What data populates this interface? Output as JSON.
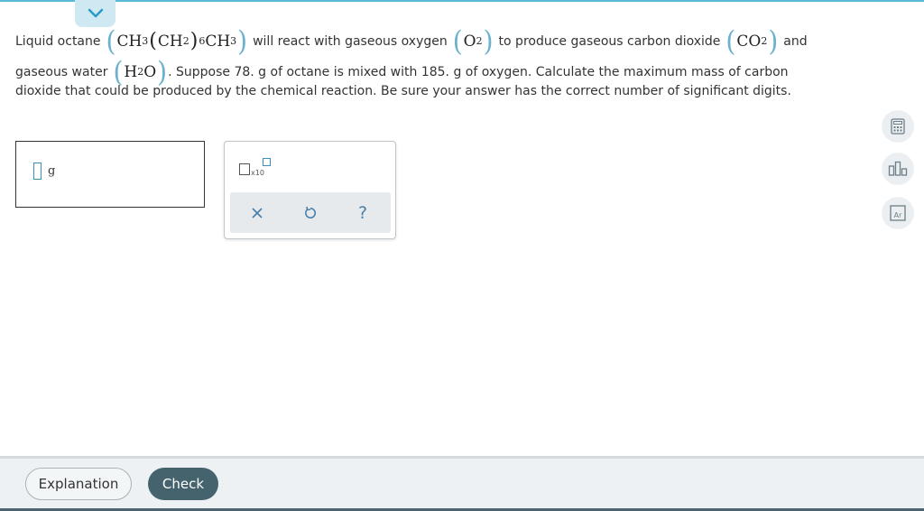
{
  "colors": {
    "accent": "#5bb8d6",
    "paren": "#6ab1cc",
    "check_button": "#44636d",
    "footer": "#eef1f3"
  },
  "question": {
    "t1": "Liquid octane",
    "octane": {
      "a": "CH",
      "a_sub": "3",
      "b": "CH",
      "b_sub": "2",
      "n": "6",
      "c": "CH",
      "c_sub": "3"
    },
    "t2": "will react with gaseous oxygen",
    "oxygen": {
      "a": "O",
      "a_sub": "2"
    },
    "t3": "to produce gaseous carbon dioxide",
    "co2": {
      "a": "CO",
      "a_sub": "2"
    },
    "t4": "and",
    "t5": "gaseous water",
    "water": {
      "a": "H",
      "a_sub": "2",
      "b": "O"
    },
    "t6": ". Suppose 78. g of octane is mixed with 185. g of oxygen. Calculate the maximum mass of carbon",
    "t7": "dioxide that could be produced by the chemical reaction. Be sure your answer has the correct number of significant digits."
  },
  "answer": {
    "value": "",
    "unit": "g"
  },
  "palette": {
    "x10_label": "x10",
    "help_glyph": "?"
  },
  "icons": {
    "collapse": "chevron-down-icon",
    "clear": "close-icon",
    "undo": "undo-icon",
    "calculator": "calculator-icon",
    "chart": "bar-chart-icon",
    "periodic_table": "periodic-table-icon"
  },
  "side_tools": {
    "periodic_label": "Ar"
  },
  "footer": {
    "explanation_label": "Explanation",
    "check_label": "Check"
  }
}
